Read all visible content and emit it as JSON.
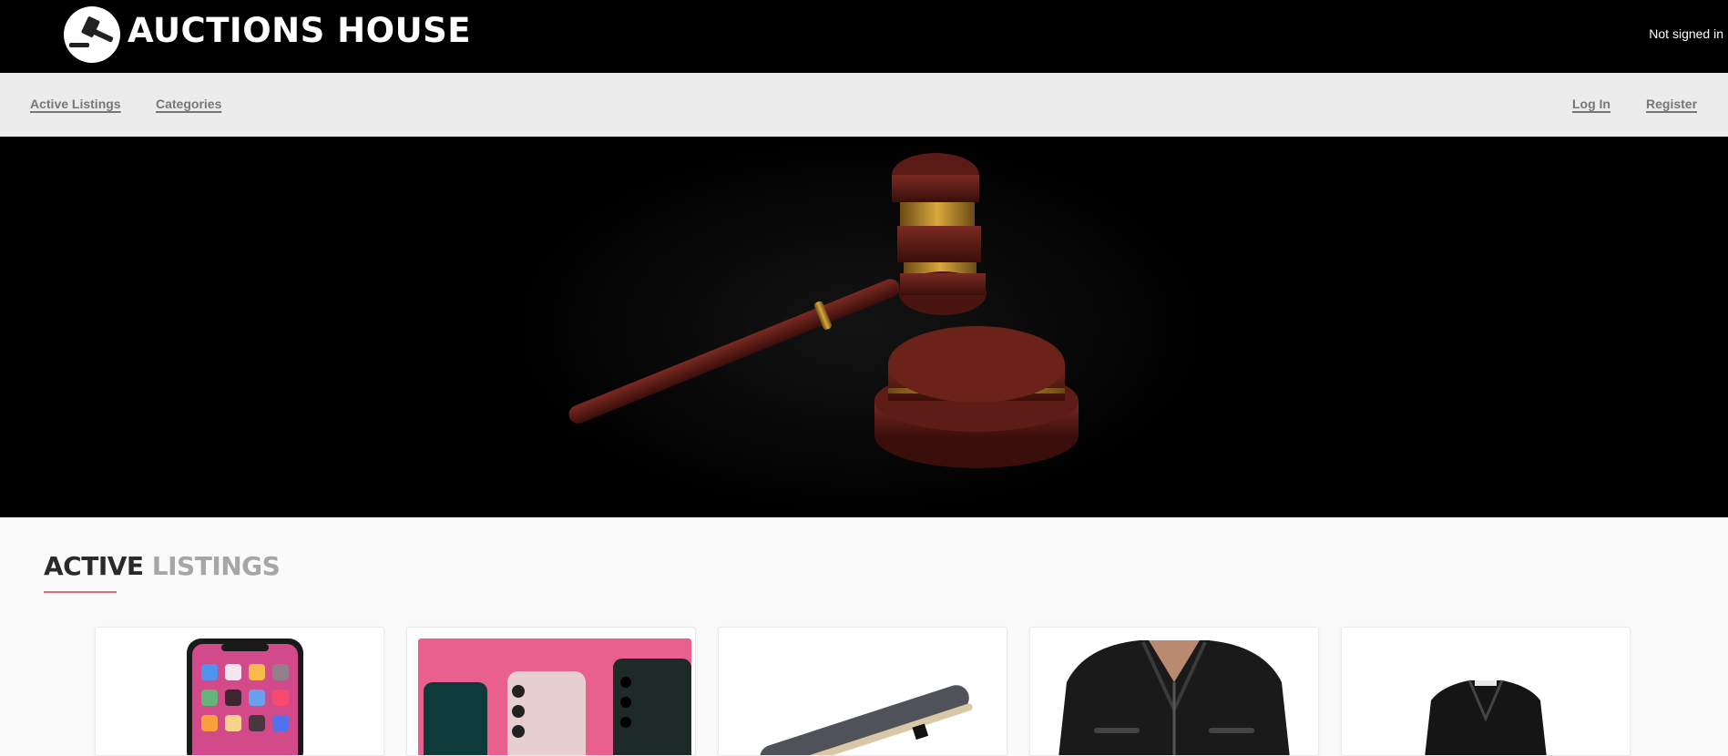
{
  "header": {
    "brand": "AUCTIONS HOUSE",
    "logo_icon": "gavel-icon",
    "auth_status": "Not signed in"
  },
  "nav": {
    "left": [
      {
        "label": "Active Listings"
      },
      {
        "label": "Categories"
      }
    ],
    "right": [
      {
        "label": "Log In"
      },
      {
        "label": "Register"
      }
    ]
  },
  "hero": {
    "image": "gavel-and-sound-block"
  },
  "section": {
    "title_part1": "ACTIVE",
    "title_part2": "LISTINGS",
    "accent_color": "#e06c75"
  },
  "listings": [
    {
      "image": "smartphone-iphone"
    },
    {
      "image": "three-smartphones-on-pink"
    },
    {
      "image": "skateboard"
    },
    {
      "image": "black-leather-jacket"
    },
    {
      "image": "black-blazer"
    }
  ]
}
